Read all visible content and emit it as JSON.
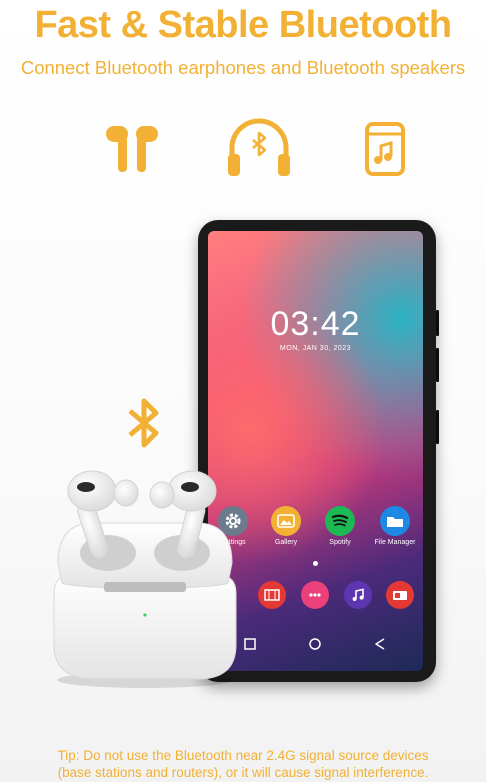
{
  "headline": "Fast & Stable Bluetooth",
  "subheadline": "Connect Bluetooth earphones and Bluetooth speakers",
  "feature_icons": [
    "earbuds-icon",
    "headphones-bluetooth-icon",
    "speaker-music-icon"
  ],
  "phone": {
    "time": "03:42",
    "date": "MON, JAN 30, 2023",
    "apps": [
      {
        "label": "Settings",
        "icon": "gear-icon",
        "color": "#6b7a8c"
      },
      {
        "label": "Gallery",
        "icon": "image-icon",
        "color": "#f2b134"
      },
      {
        "label": "Spotify",
        "icon": "spotify-icon",
        "color": "#1db954"
      },
      {
        "label": "File Manager",
        "icon": "folder-icon",
        "color": "#1e88e5"
      }
    ],
    "dock": [
      {
        "icon": "video-icon",
        "color": "#e53935"
      },
      {
        "icon": "apps-grid-icon",
        "color": "#ec407a"
      },
      {
        "icon": "music-note-icon",
        "color": "#5e35b1"
      },
      {
        "icon": "radio-icon",
        "color": "#e53935"
      }
    ],
    "nav": [
      "square-icon",
      "circle-icon",
      "back-triangle-icon"
    ]
  },
  "tip": {
    "line1": "Tip: Do not use the Bluetooth near 2.4G signal source devices",
    "line2": "(base stations and routers), or it will cause signal interference."
  },
  "colors": {
    "accent": "#f2b134",
    "phone_body": "#1a1a1a"
  }
}
